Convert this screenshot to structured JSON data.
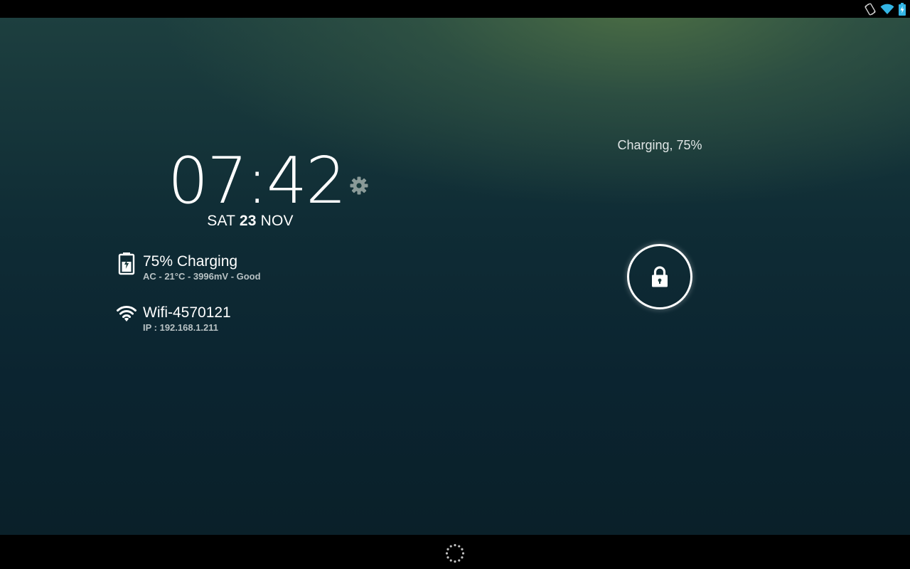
{
  "status_bar": {
    "icons": [
      "screen-rotation-icon",
      "wifi-icon",
      "battery-charging-icon"
    ],
    "accent_color": "#33b5e5"
  },
  "clock": {
    "hours": "07",
    "separator": ":",
    "minutes": "42"
  },
  "date": {
    "weekday": "SAT",
    "day": "23",
    "month": "NOV"
  },
  "battery": {
    "icon": "battery-charging-icon",
    "title": "75% Charging",
    "details": "AC - 21°C - 3996mV - Good",
    "level": 0.75
  },
  "wifi": {
    "icon": "wifi-icon",
    "title": "Wifi-4570121",
    "details": "IP : 192.168.1.211"
  },
  "lockscreen": {
    "charging_status": "Charging, 75%",
    "lock_icon": "lock-icon"
  },
  "nav_bar": {
    "icon": "loading-spinner-icon"
  }
}
